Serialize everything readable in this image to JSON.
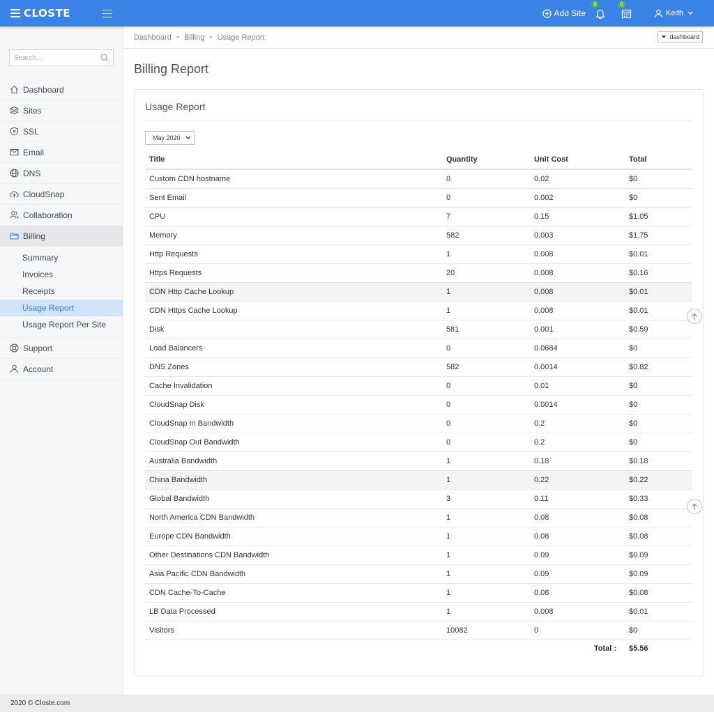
{
  "brand": {
    "name": "CLOSTE"
  },
  "topbar": {
    "add_site_label": "Add Site",
    "notifications_count": "0",
    "calendar_count": "0",
    "user_name": "Keith"
  },
  "sidebar": {
    "search_placeholder": "Search...",
    "items": [
      {
        "label": "Dashboard",
        "icon": "home-icon"
      },
      {
        "label": "Sites",
        "icon": "layers-icon"
      },
      {
        "label": "SSL",
        "icon": "shield-icon"
      },
      {
        "label": "Email",
        "icon": "mail-icon"
      },
      {
        "label": "DNS",
        "icon": "globe-icon"
      },
      {
        "label": "CloudSnap",
        "icon": "cloud-upload-icon"
      },
      {
        "label": "Collaboration",
        "icon": "users-icon"
      },
      {
        "label": "Billing",
        "icon": "folder-icon"
      }
    ],
    "billing_sub": [
      {
        "label": "Summary"
      },
      {
        "label": "Invoices"
      },
      {
        "label": "Receipts"
      },
      {
        "label": "Usage Report"
      },
      {
        "label": "Usage Report Per Site"
      }
    ],
    "bottom_items": [
      {
        "label": "Support",
        "icon": "lifebuoy-icon"
      },
      {
        "label": "Account",
        "icon": "user-icon"
      }
    ]
  },
  "breadcrumb": [
    "Dashboard",
    "Billing",
    "Usage Report"
  ],
  "dashboard_select": "dashboard",
  "page_title": "Billing Report",
  "card": {
    "title": "Usage Report",
    "month": "May 2020"
  },
  "table": {
    "headers": [
      "Title",
      "Quantity",
      "Unit Cost",
      "Total"
    ],
    "rows": [
      [
        "Custom CDN hostname",
        "0",
        "0.02",
        "$0"
      ],
      [
        "Sent Email",
        "0",
        "0.002",
        "$0"
      ],
      [
        "CPU",
        "7",
        "0.15",
        "$1.05"
      ],
      [
        "Memory",
        "582",
        "0.003",
        "$1.75"
      ],
      [
        "Http Requests",
        "1",
        "0.008",
        "$0.01"
      ],
      [
        "Https Requests",
        "20",
        "0.008",
        "$0.16"
      ],
      [
        "CDN Http Cache Lookup",
        "1",
        "0.008",
        "$0.01"
      ],
      [
        "CDN Https Cache Lookup",
        "1",
        "0.008",
        "$0.01"
      ],
      [
        "Disk",
        "581",
        "0.001",
        "$0.59"
      ],
      [
        "Load Balancers",
        "0",
        "0.0684",
        "$0"
      ],
      [
        "DNS Zones",
        "582",
        "0.0014",
        "$0.82"
      ],
      [
        "Cache Invalidation",
        "0",
        "0.01",
        "$0"
      ],
      [
        "CloudSnap Disk",
        "0",
        "0.0014",
        "$0"
      ],
      [
        "CloudSnap In Bandwidth",
        "0",
        "0.2",
        "$0"
      ],
      [
        "CloudSnap Out Bandwidth",
        "0",
        "0.2",
        "$0"
      ],
      [
        "Australia Bandwidth",
        "1",
        "0.18",
        "$0.18"
      ],
      [
        "China Bandwidth",
        "1",
        "0.22",
        "$0.22"
      ],
      [
        "Global Bandwidth",
        "3",
        "0.11",
        "$0.33"
      ],
      [
        "North America CDN Bandwidth",
        "1",
        "0.08",
        "$0.08"
      ],
      [
        "Europe CDN Bandwidth",
        "1",
        "0.08",
        "$0.08"
      ],
      [
        "Other Destinations CDN Bandwidth",
        "1",
        "0.09",
        "$0.09"
      ],
      [
        "Asia Pacific CDN Bandwidth",
        "1",
        "0.09",
        "$0.09"
      ],
      [
        "CDN Cache-To-Cache",
        "1",
        "0.08",
        "$0.08"
      ],
      [
        "LB Data Processed",
        "1",
        "0.008",
        "$0.01"
      ],
      [
        "Visitors",
        "10082",
        "0",
        "$0"
      ]
    ],
    "total_label": "Total :",
    "total_value": "$5.56"
  },
  "footer": {
    "text": "2020 © Closte.com"
  },
  "colors": {
    "primary": "#3b82e6",
    "badge": "#4caf50",
    "active_sub_bg": "#d2e2f7"
  }
}
